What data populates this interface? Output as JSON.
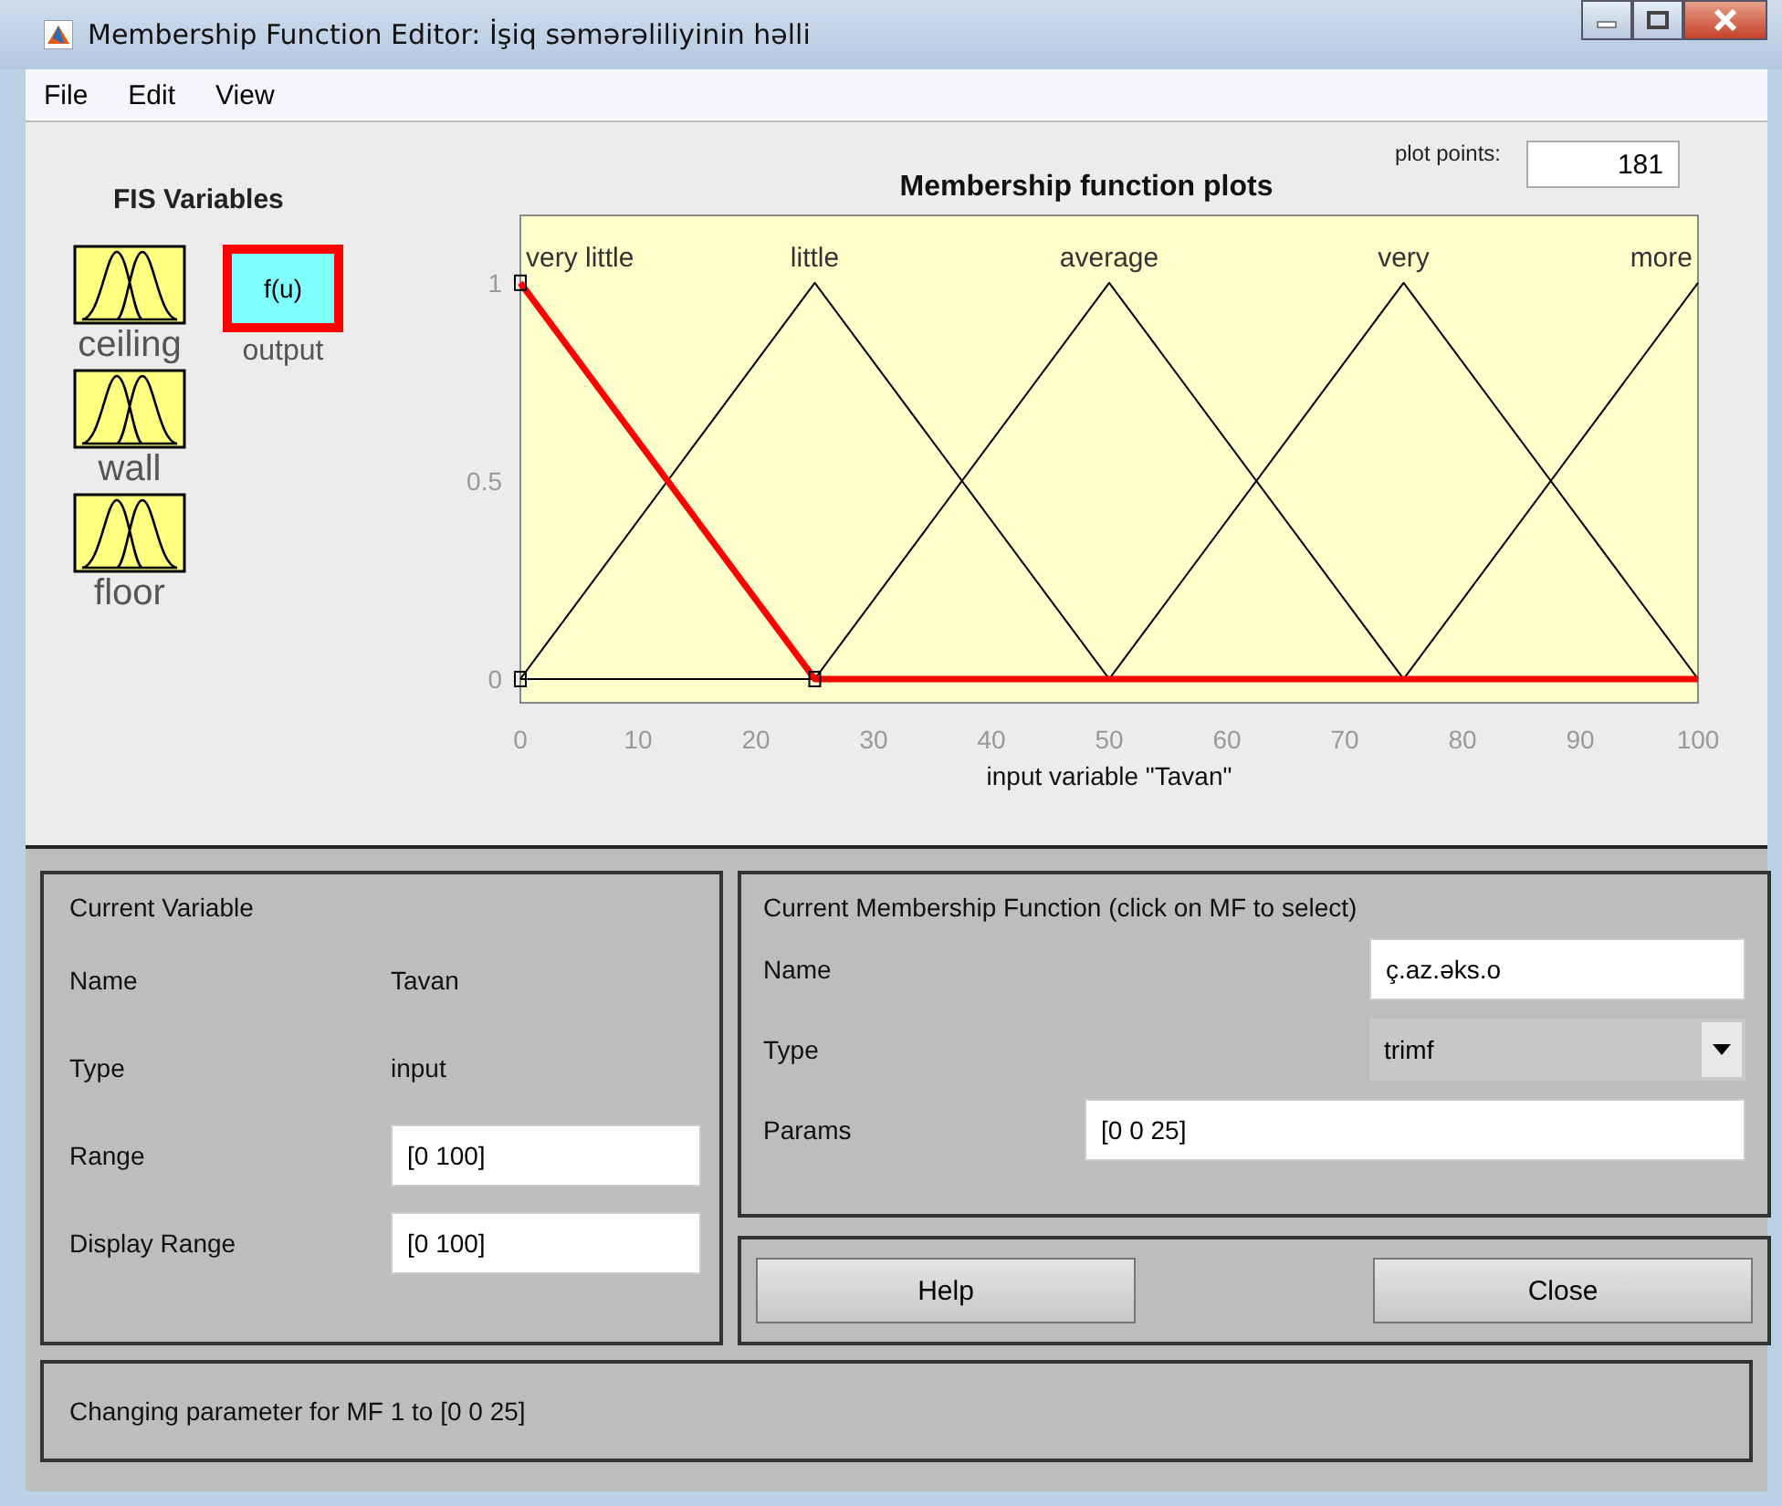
{
  "window": {
    "title": "Membership Function Editor: İşiq səmərəliliyinin həlli"
  },
  "menu": [
    "File",
    "Edit",
    "View"
  ],
  "fis_variables": {
    "title": "FIS Variables",
    "items": [
      {
        "name": "ceiling",
        "kind": "input",
        "selected": false
      },
      {
        "name": "wall",
        "kind": "input",
        "selected": false
      },
      {
        "name": "floor",
        "kind": "input",
        "selected": false
      },
      {
        "name": "output",
        "kind": "output",
        "icon_text": "f(u)",
        "selected": true
      }
    ]
  },
  "plot": {
    "plot_points_label": "plot points:",
    "plot_points": "181",
    "chart_data": {
      "type": "line",
      "title": "Membership function plots",
      "xlabel": "input variable \"Tavan\"",
      "x": [
        0,
        25,
        50,
        75,
        100
      ],
      "xlim": [
        0,
        100
      ],
      "ylim": [
        -0.06,
        1.17
      ],
      "xticks": [
        0,
        10,
        20,
        30,
        40,
        50,
        60,
        70,
        80,
        90,
        100
      ],
      "yticks": [
        0,
        0.5,
        1
      ],
      "series": [
        {
          "name": "very little",
          "color": "#ff0000",
          "values": [
            1,
            0,
            0,
            0,
            0
          ]
        },
        {
          "name": "little",
          "color": "#000000",
          "values": [
            0,
            1,
            0,
            0,
            0
          ]
        },
        {
          "name": "average",
          "color": "#000000",
          "values": [
            0,
            0,
            1,
            0,
            0
          ]
        },
        {
          "name": "very",
          "color": "#000000",
          "values": [
            0,
            0,
            0,
            1,
            0
          ]
        },
        {
          "name": "more",
          "color": "#000000",
          "values": [
            0,
            0,
            0,
            0,
            1
          ]
        }
      ]
    }
  },
  "current_variable": {
    "title": "Current Variable",
    "name_label": "Name",
    "name": "Tavan",
    "type_label": "Type",
    "type": "input",
    "range_label": "Range",
    "range": "[0 100]",
    "display_range_label": "Display Range",
    "display_range": "[0 100]"
  },
  "current_mf": {
    "title": "Current Membership Function (click on MF to select)",
    "name_label": "Name",
    "name": "ç.az.əks.o",
    "type_label": "Type",
    "type": "trimf",
    "params_label": "Params",
    "params": "[0 0 25]"
  },
  "buttons": [
    "Help",
    "Close"
  ],
  "status": "Changing parameter for MF 1 to  [0 0 25]"
}
